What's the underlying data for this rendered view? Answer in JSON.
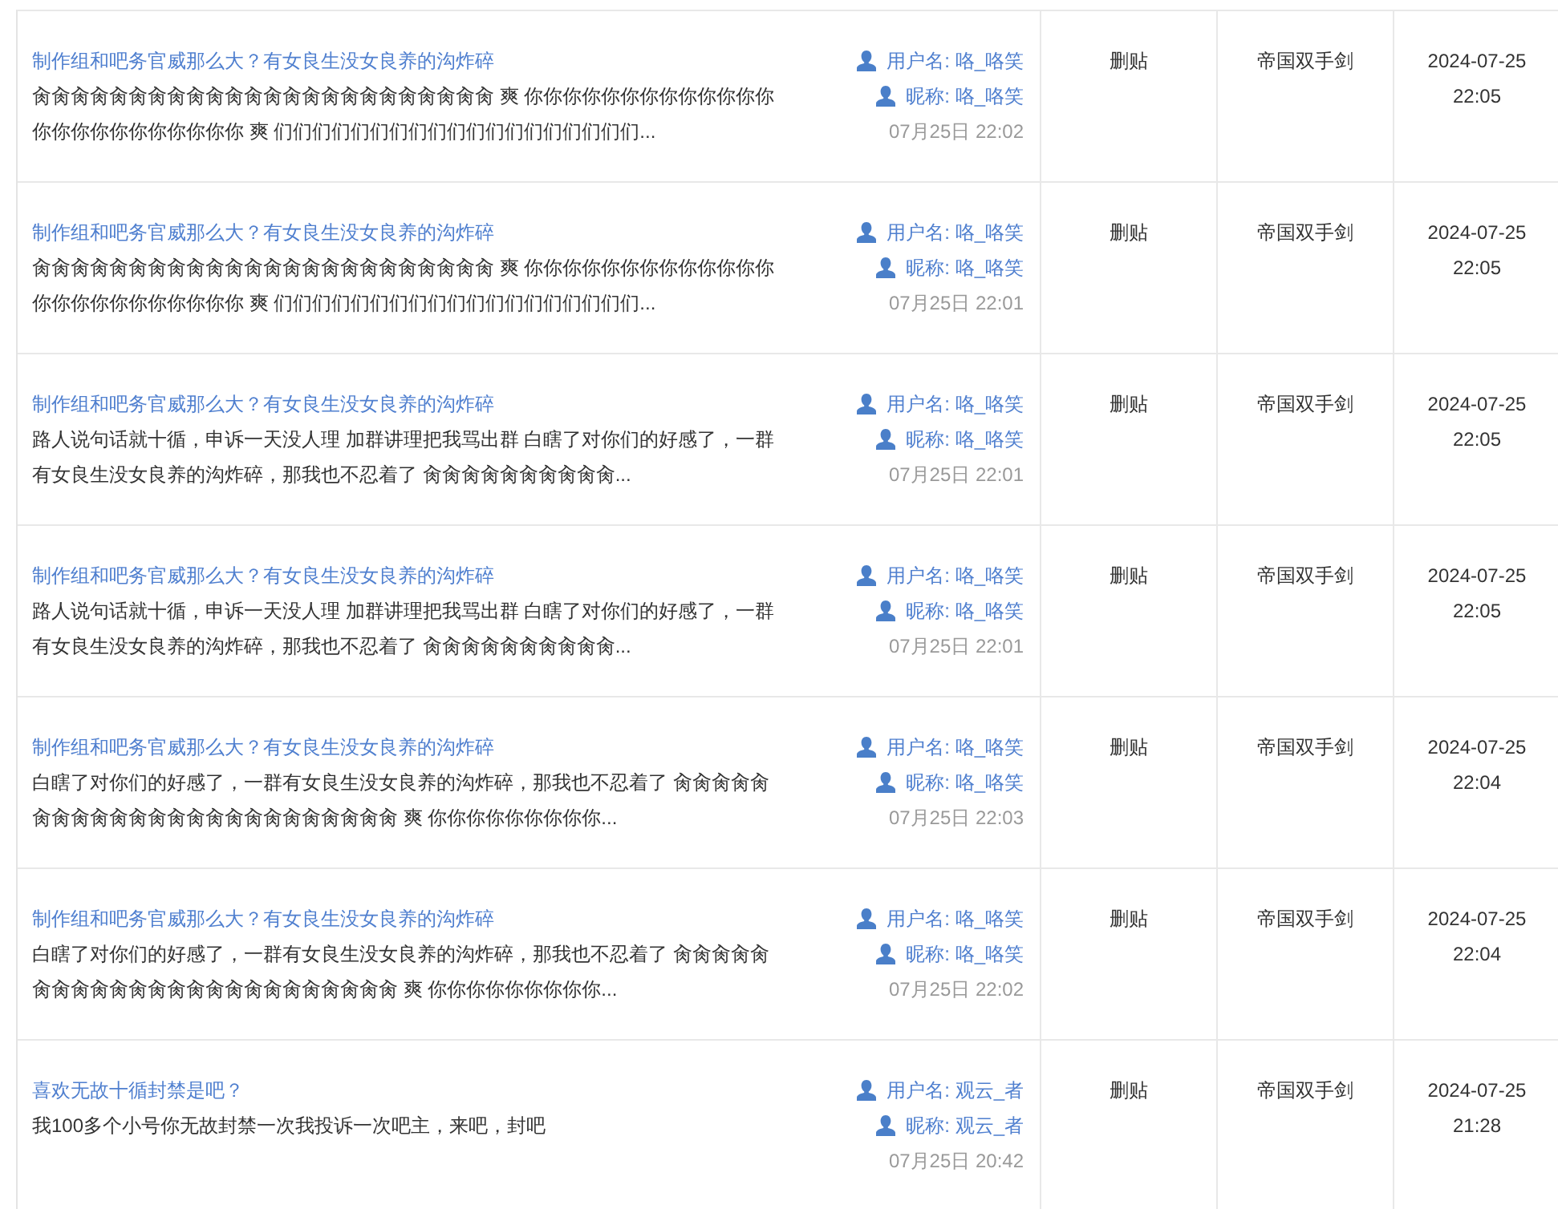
{
  "rows": [
    {
      "title": "制作组和吧务官威那么大？有女良生没女良养的沟炸碎",
      "body": "肏肏肏肏肏肏肏肏肏肏肏肏肏肏肏肏肏肏肏肏肏肏肏肏 爽 你你你你你你你你你你你你你你你你你你你你你你你你 爽 们们们们们们们们们们们们们们们们们们们...",
      "username": "用户名: 咯_咯笑",
      "nickname": "昵称: 咯_咯笑",
      "posted": "07月25日 22:02",
      "action": "删贴",
      "operator": "帝国双手剑",
      "date": "2024-07-25",
      "time": "22:05"
    },
    {
      "title": "制作组和吧务官威那么大？有女良生没女良养的沟炸碎",
      "body": "肏肏肏肏肏肏肏肏肏肏肏肏肏肏肏肏肏肏肏肏肏肏肏肏 爽 你你你你你你你你你你你你你你你你你你你你你你你你 爽 们们们们们们们们们们们们们们们们们们们...",
      "username": "用户名: 咯_咯笑",
      "nickname": "昵称: 咯_咯笑",
      "posted": "07月25日 22:01",
      "action": "删贴",
      "operator": "帝国双手剑",
      "date": "2024-07-25",
      "time": "22:05"
    },
    {
      "title": "制作组和吧务官威那么大？有女良生没女良养的沟炸碎",
      "body": "路人说句话就十循，申诉一天没人理 加群讲理把我骂出群 白瞎了对你们的好感了，一群有女良生没女良养的沟炸碎，那我也不忍着了 肏肏肏肏肏肏肏肏肏肏...",
      "username": "用户名: 咯_咯笑",
      "nickname": "昵称: 咯_咯笑",
      "posted": "07月25日 22:01",
      "action": "删贴",
      "operator": "帝国双手剑",
      "date": "2024-07-25",
      "time": "22:05"
    },
    {
      "title": "制作组和吧务官威那么大？有女良生没女良养的沟炸碎",
      "body": "路人说句话就十循，申诉一天没人理 加群讲理把我骂出群 白瞎了对你们的好感了，一群有女良生没女良养的沟炸碎，那我也不忍着了 肏肏肏肏肏肏肏肏肏肏...",
      "username": "用户名: 咯_咯笑",
      "nickname": "昵称: 咯_咯笑",
      "posted": "07月25日 22:01",
      "action": "删贴",
      "operator": "帝国双手剑",
      "date": "2024-07-25",
      "time": "22:05"
    },
    {
      "title": "制作组和吧务官威那么大？有女良生没女良养的沟炸碎",
      "body": "白瞎了对你们的好感了，一群有女良生没女良养的沟炸碎，那我也不忍着了 肏肏肏肏肏肏肏肏肏肏肏肏肏肏肏肏肏肏肏肏肏肏肏肏 爽 你你你你你你你你你...",
      "username": "用户名: 咯_咯笑",
      "nickname": "昵称: 咯_咯笑",
      "posted": "07月25日 22:03",
      "action": "删贴",
      "operator": "帝国双手剑",
      "date": "2024-07-25",
      "time": "22:04"
    },
    {
      "title": "制作组和吧务官威那么大？有女良生没女良养的沟炸碎",
      "body": "白瞎了对你们的好感了，一群有女良生没女良养的沟炸碎，那我也不忍着了 肏肏肏肏肏肏肏肏肏肏肏肏肏肏肏肏肏肏肏肏肏肏肏肏 爽 你你你你你你你你你...",
      "username": "用户名: 咯_咯笑",
      "nickname": "昵称: 咯_咯笑",
      "posted": "07月25日 22:02",
      "action": "删贴",
      "operator": "帝国双手剑",
      "date": "2024-07-25",
      "time": "22:04"
    },
    {
      "title": "喜欢无故十循封禁是吧？",
      "body": "我100多个小号你无故封禁一次我投诉一次吧主，来吧，封吧",
      "username": "用户名: 观云_者",
      "nickname": "昵称: 观云_者",
      "posted": "07月25日 20:42",
      "action": "删贴",
      "operator": "帝国双手剑",
      "date": "2024-07-25",
      "time": "21:28"
    }
  ]
}
